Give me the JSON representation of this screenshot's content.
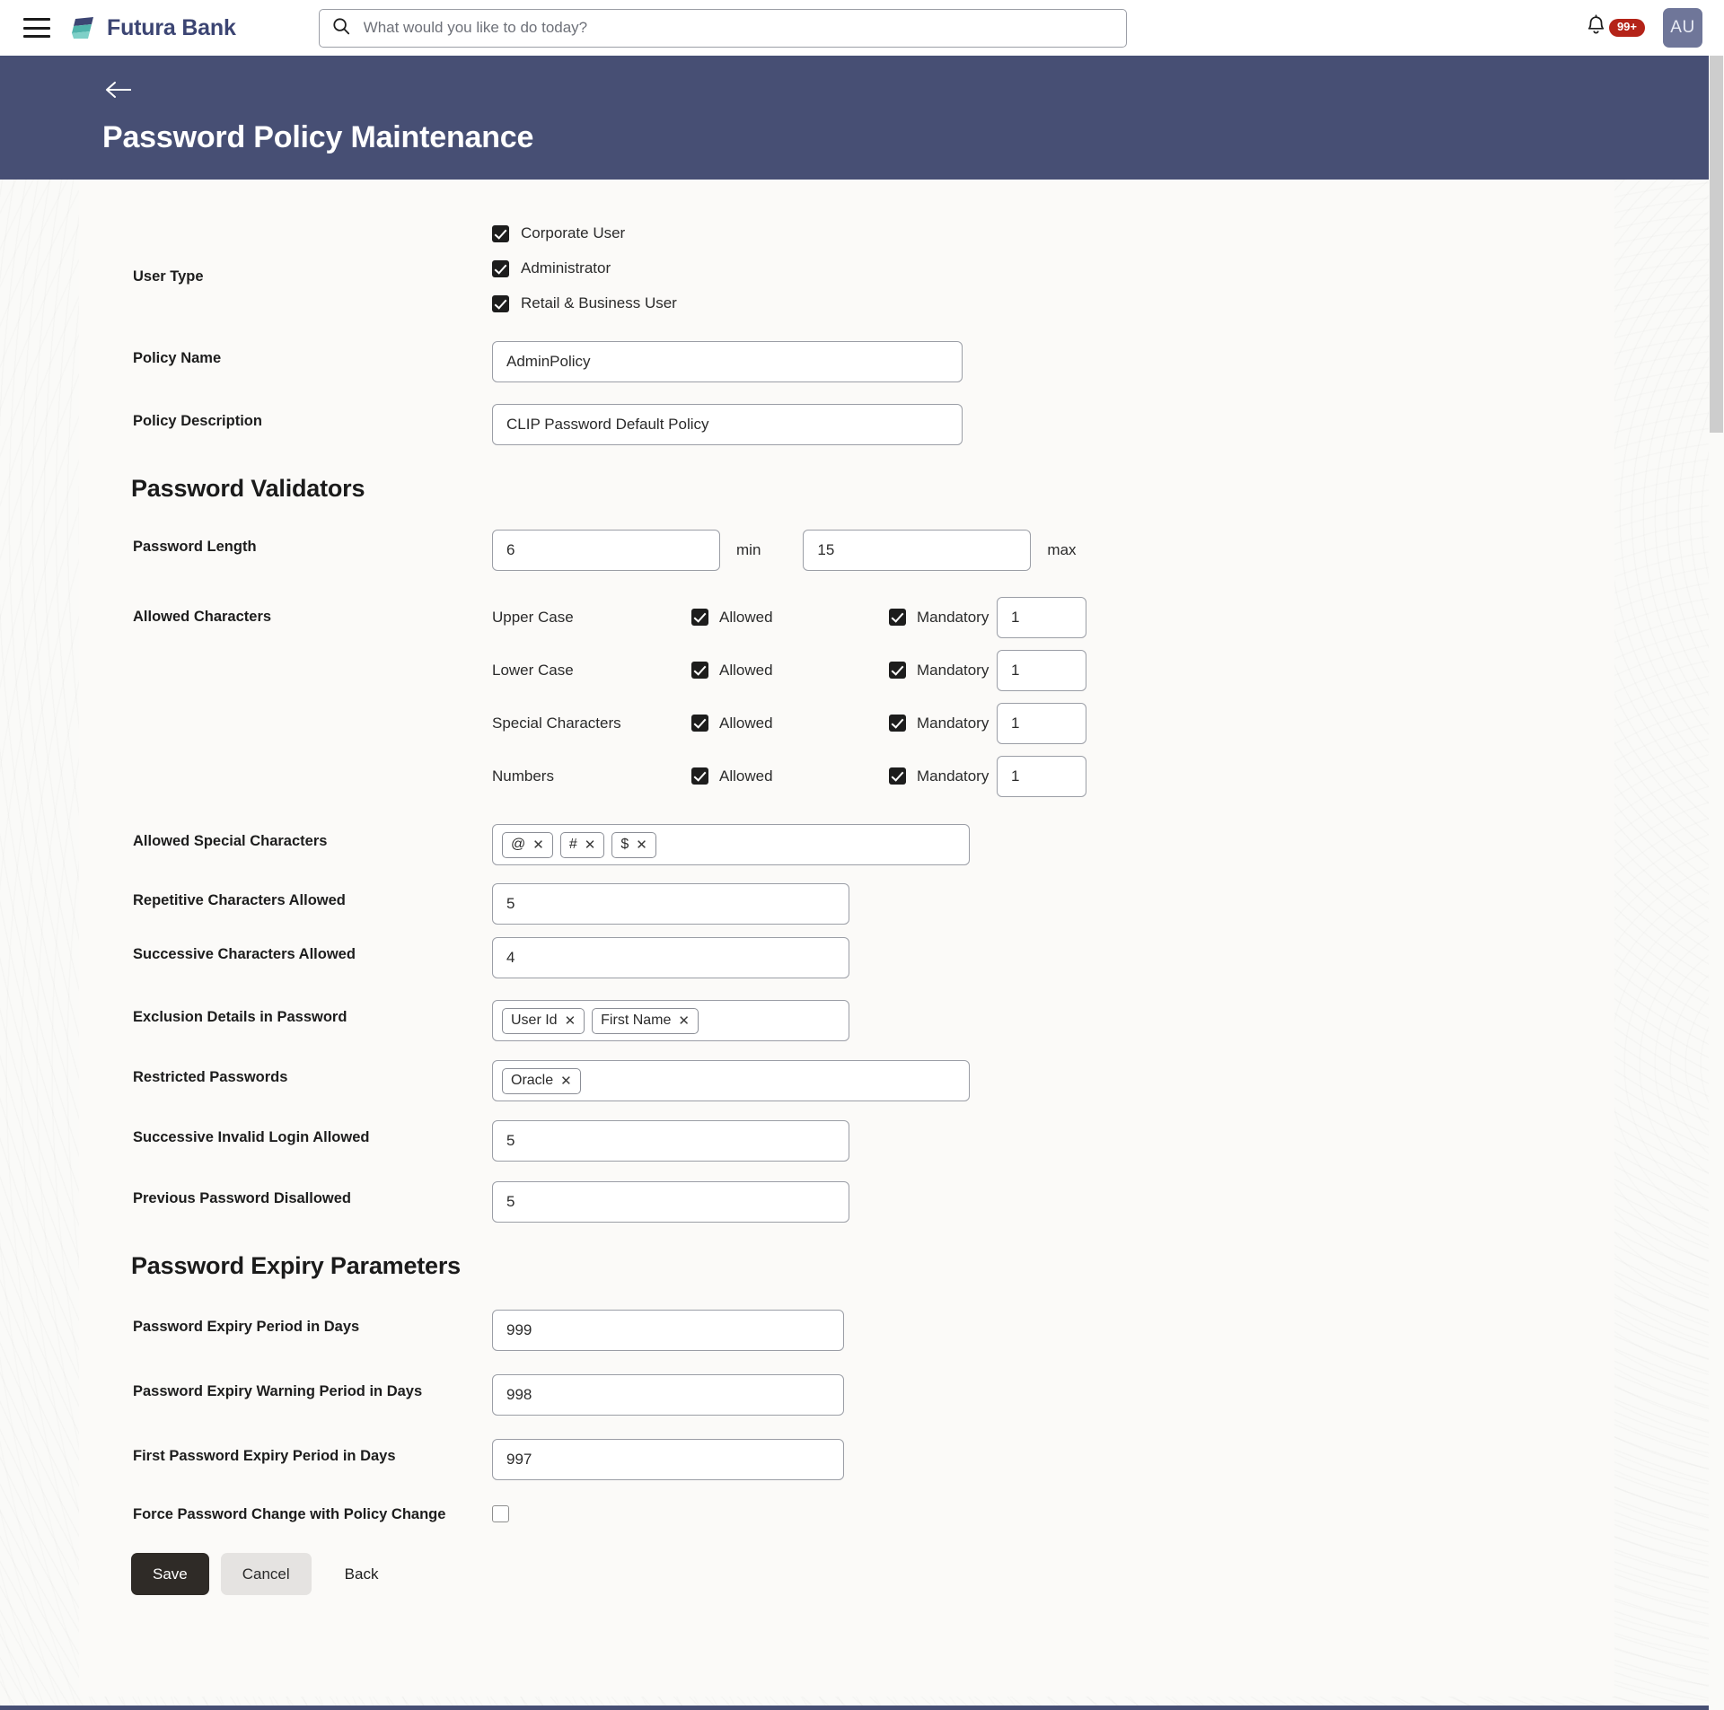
{
  "topbar": {
    "menu_icon": "hamburger-icon",
    "brand": "Futura Bank",
    "search_placeholder": "What would you like to do today?",
    "search_value": "",
    "search_icon": "search-icon",
    "bell_icon": "bell-icon",
    "notification_badge": "99+",
    "avatar_initials": "AU"
  },
  "hero": {
    "back_icon": "back-arrow-icon",
    "title": "Password Policy Maintenance"
  },
  "form": {
    "user_type": {
      "label": "User Type",
      "options": [
        {
          "label": "Corporate User",
          "checked": true
        },
        {
          "label": "Administrator",
          "checked": true
        },
        {
          "label": "Retail & Business User",
          "checked": true
        }
      ]
    },
    "policy_name": {
      "label": "Policy Name",
      "value": "AdminPolicy",
      "placeholder": ""
    },
    "policy_description": {
      "label": "Policy Description",
      "value": "CLIP Password Default Policy",
      "placeholder": ""
    },
    "validators_heading": "Password Validators",
    "password_length": {
      "label": "Password Length",
      "min_value": "6",
      "min_unit": "min",
      "max_value": "15",
      "max_unit": "max"
    },
    "allowed_characters": {
      "label": "Allowed Characters",
      "allowed_label": "Allowed",
      "mandatory_label": "Mandatory",
      "rows": [
        {
          "name": "Upper Case",
          "allowed": true,
          "mandatory": true,
          "count": "1"
        },
        {
          "name": "Lower Case",
          "allowed": true,
          "mandatory": true,
          "count": "1"
        },
        {
          "name": "Special Characters",
          "allowed": true,
          "mandatory": true,
          "count": "1"
        },
        {
          "name": "Numbers",
          "allowed": true,
          "mandatory": true,
          "count": "1"
        }
      ]
    },
    "allowed_special_characters": {
      "label": "Allowed Special Characters",
      "chips": [
        "@",
        "#",
        "$"
      ]
    },
    "repetitive_characters": {
      "label": "Repetitive Characters Allowed",
      "value": "5"
    },
    "successive_characters": {
      "label": "Successive Characters Allowed",
      "value": "4"
    },
    "exclusion_details": {
      "label": "Exclusion Details in Password",
      "chips": [
        "User Id",
        "First Name"
      ]
    },
    "restricted_passwords": {
      "label": "Restricted Passwords",
      "chips": [
        "Oracle"
      ]
    },
    "successive_invalid_login": {
      "label": "Successive Invalid Login Allowed",
      "value": "5"
    },
    "previous_password_disallowed": {
      "label": "Previous Password Disallowed",
      "value": "5"
    },
    "expiry_heading": "Password Expiry Parameters",
    "expiry_period": {
      "label": "Password Expiry Period in Days",
      "value": "999"
    },
    "expiry_warning_period": {
      "label": "Password Expiry Warning Period in Days",
      "value": "998"
    },
    "first_expiry_period": {
      "label": "First Password Expiry Period in Days",
      "value": "997"
    },
    "force_change": {
      "label": "Force Password Change with Policy Change",
      "checked": false
    }
  },
  "actions": {
    "save": "Save",
    "cancel": "Cancel",
    "back": "Back"
  },
  "colors": {
    "hero_background": "#474f74",
    "brand_text": "#3c4573",
    "badge": "#b42318",
    "primary_button": "#2f2b27",
    "avatar": "#6f7699"
  }
}
